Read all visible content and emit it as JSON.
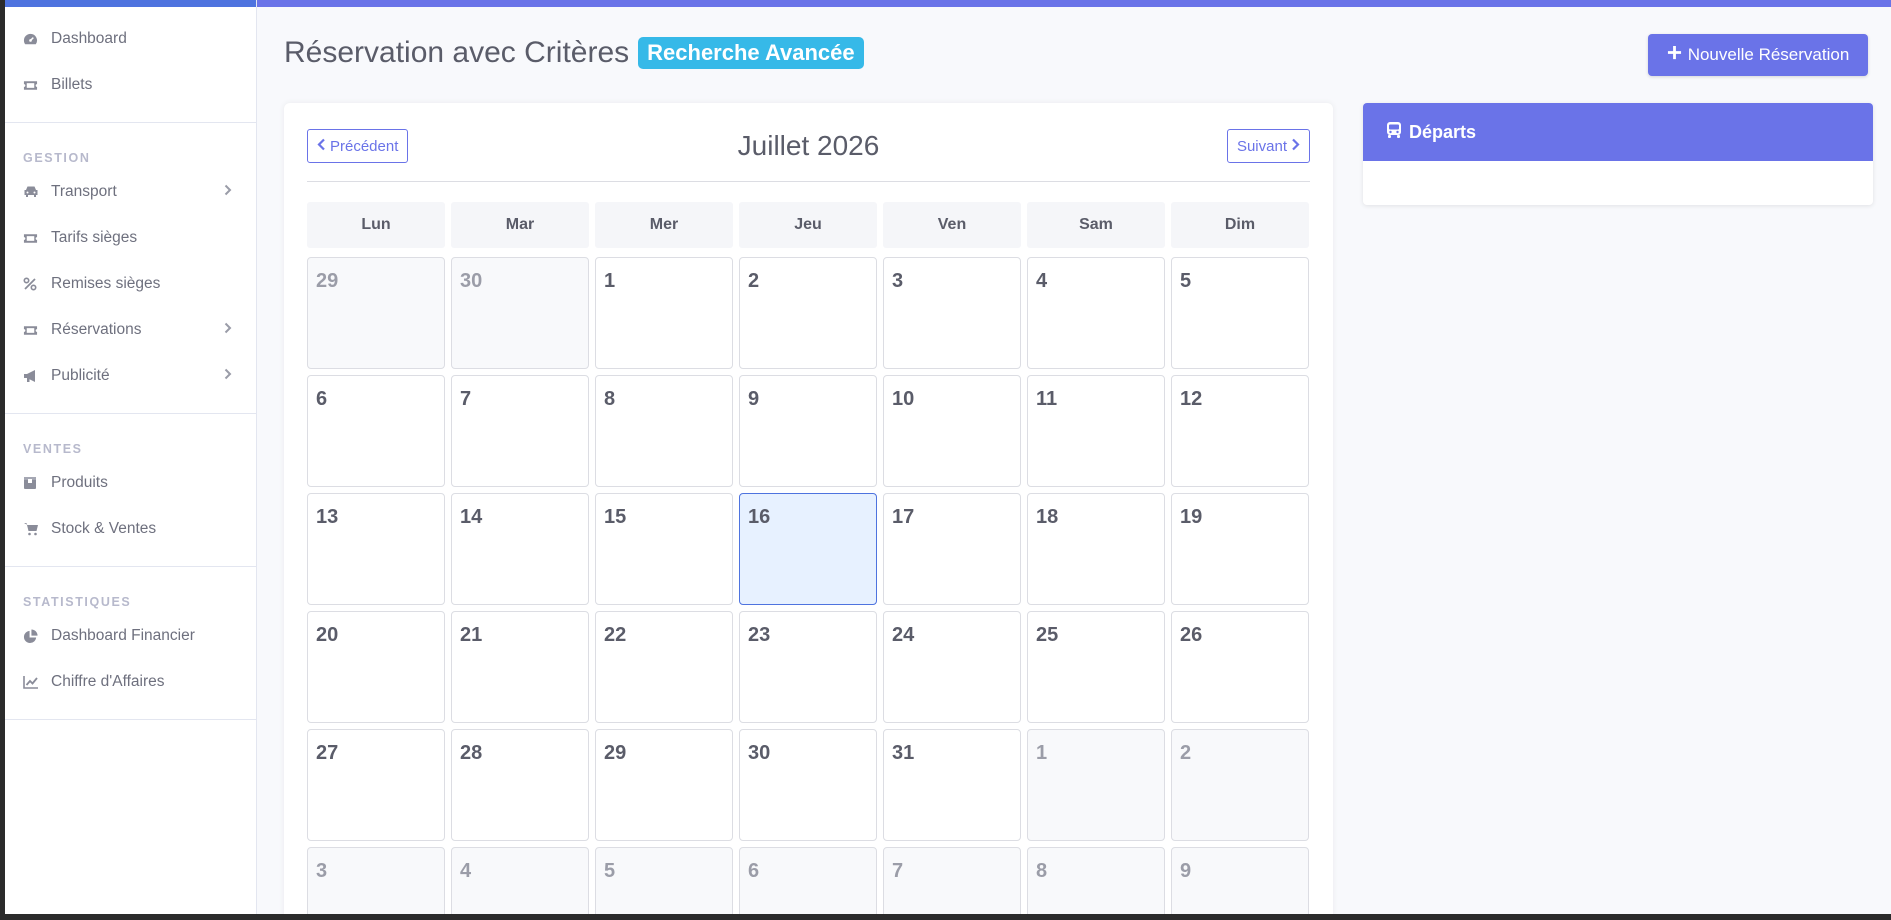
{
  "sidebar": {
    "items_top": [
      {
        "label": "Dashboard",
        "icon": "gauge-icon"
      },
      {
        "label": "Billets",
        "icon": "ticket-icon"
      }
    ],
    "gestion_heading": "GESTION",
    "gestion_items": [
      {
        "label": "Transport",
        "icon": "car-icon",
        "has_submenu": true
      },
      {
        "label": "Tarifs sièges",
        "icon": "ticket-icon",
        "has_submenu": false
      },
      {
        "label": "Remises sièges",
        "icon": "percent-icon",
        "has_submenu": false
      },
      {
        "label": "Réservations",
        "icon": "ticket-icon",
        "has_submenu": true
      },
      {
        "label": "Publicité",
        "icon": "megaphone-icon",
        "has_submenu": true
      }
    ],
    "ventes_heading": "VENTES",
    "ventes_items": [
      {
        "label": "Produits",
        "icon": "box-icon"
      },
      {
        "label": "Stock & Ventes",
        "icon": "cart-icon"
      }
    ],
    "stats_heading": "STATISTIQUES",
    "stats_items": [
      {
        "label": "Dashboard Financier",
        "icon": "pie-chart-icon"
      },
      {
        "label": "Chiffre d'Affaires",
        "icon": "line-chart-icon"
      }
    ]
  },
  "header": {
    "title": "Réservation avec Critères",
    "badge": "Recherche Avancée",
    "new_button": "Nouvelle Réservation"
  },
  "calendar": {
    "prev_label": "Précédent",
    "next_label": "Suivant",
    "month_label": "Juillet 2026",
    "weekdays": [
      "Lun",
      "Mar",
      "Mer",
      "Jeu",
      "Ven",
      "Sam",
      "Dim"
    ],
    "weeks": [
      [
        {
          "d": "29",
          "o": true
        },
        {
          "d": "30",
          "o": true
        },
        {
          "d": "1"
        },
        {
          "d": "2"
        },
        {
          "d": "3"
        },
        {
          "d": "4"
        },
        {
          "d": "5"
        }
      ],
      [
        {
          "d": "6"
        },
        {
          "d": "7"
        },
        {
          "d": "8"
        },
        {
          "d": "9"
        },
        {
          "d": "10"
        },
        {
          "d": "11"
        },
        {
          "d": "12"
        }
      ],
      [
        {
          "d": "13"
        },
        {
          "d": "14"
        },
        {
          "d": "15"
        },
        {
          "d": "16",
          "today": true
        },
        {
          "d": "17"
        },
        {
          "d": "18"
        },
        {
          "d": "19"
        }
      ],
      [
        {
          "d": "20"
        },
        {
          "d": "21"
        },
        {
          "d": "22"
        },
        {
          "d": "23"
        },
        {
          "d": "24"
        },
        {
          "d": "25"
        },
        {
          "d": "26"
        }
      ],
      [
        {
          "d": "27"
        },
        {
          "d": "28"
        },
        {
          "d": "29"
        },
        {
          "d": "30"
        },
        {
          "d": "31"
        },
        {
          "d": "1",
          "o": true
        },
        {
          "d": "2",
          "o": true
        }
      ],
      [
        {
          "d": "3",
          "o": true
        },
        {
          "d": "4",
          "o": true
        },
        {
          "d": "5",
          "o": true
        },
        {
          "d": "6",
          "o": true
        },
        {
          "d": "7",
          "o": true
        },
        {
          "d": "8",
          "o": true
        },
        {
          "d": "9",
          "o": true
        }
      ]
    ]
  },
  "departures": {
    "title": "Départs"
  },
  "colors": {
    "accent": "#6a73e8",
    "badge": "#36b9e8",
    "today_bg": "#e7f1ff"
  }
}
